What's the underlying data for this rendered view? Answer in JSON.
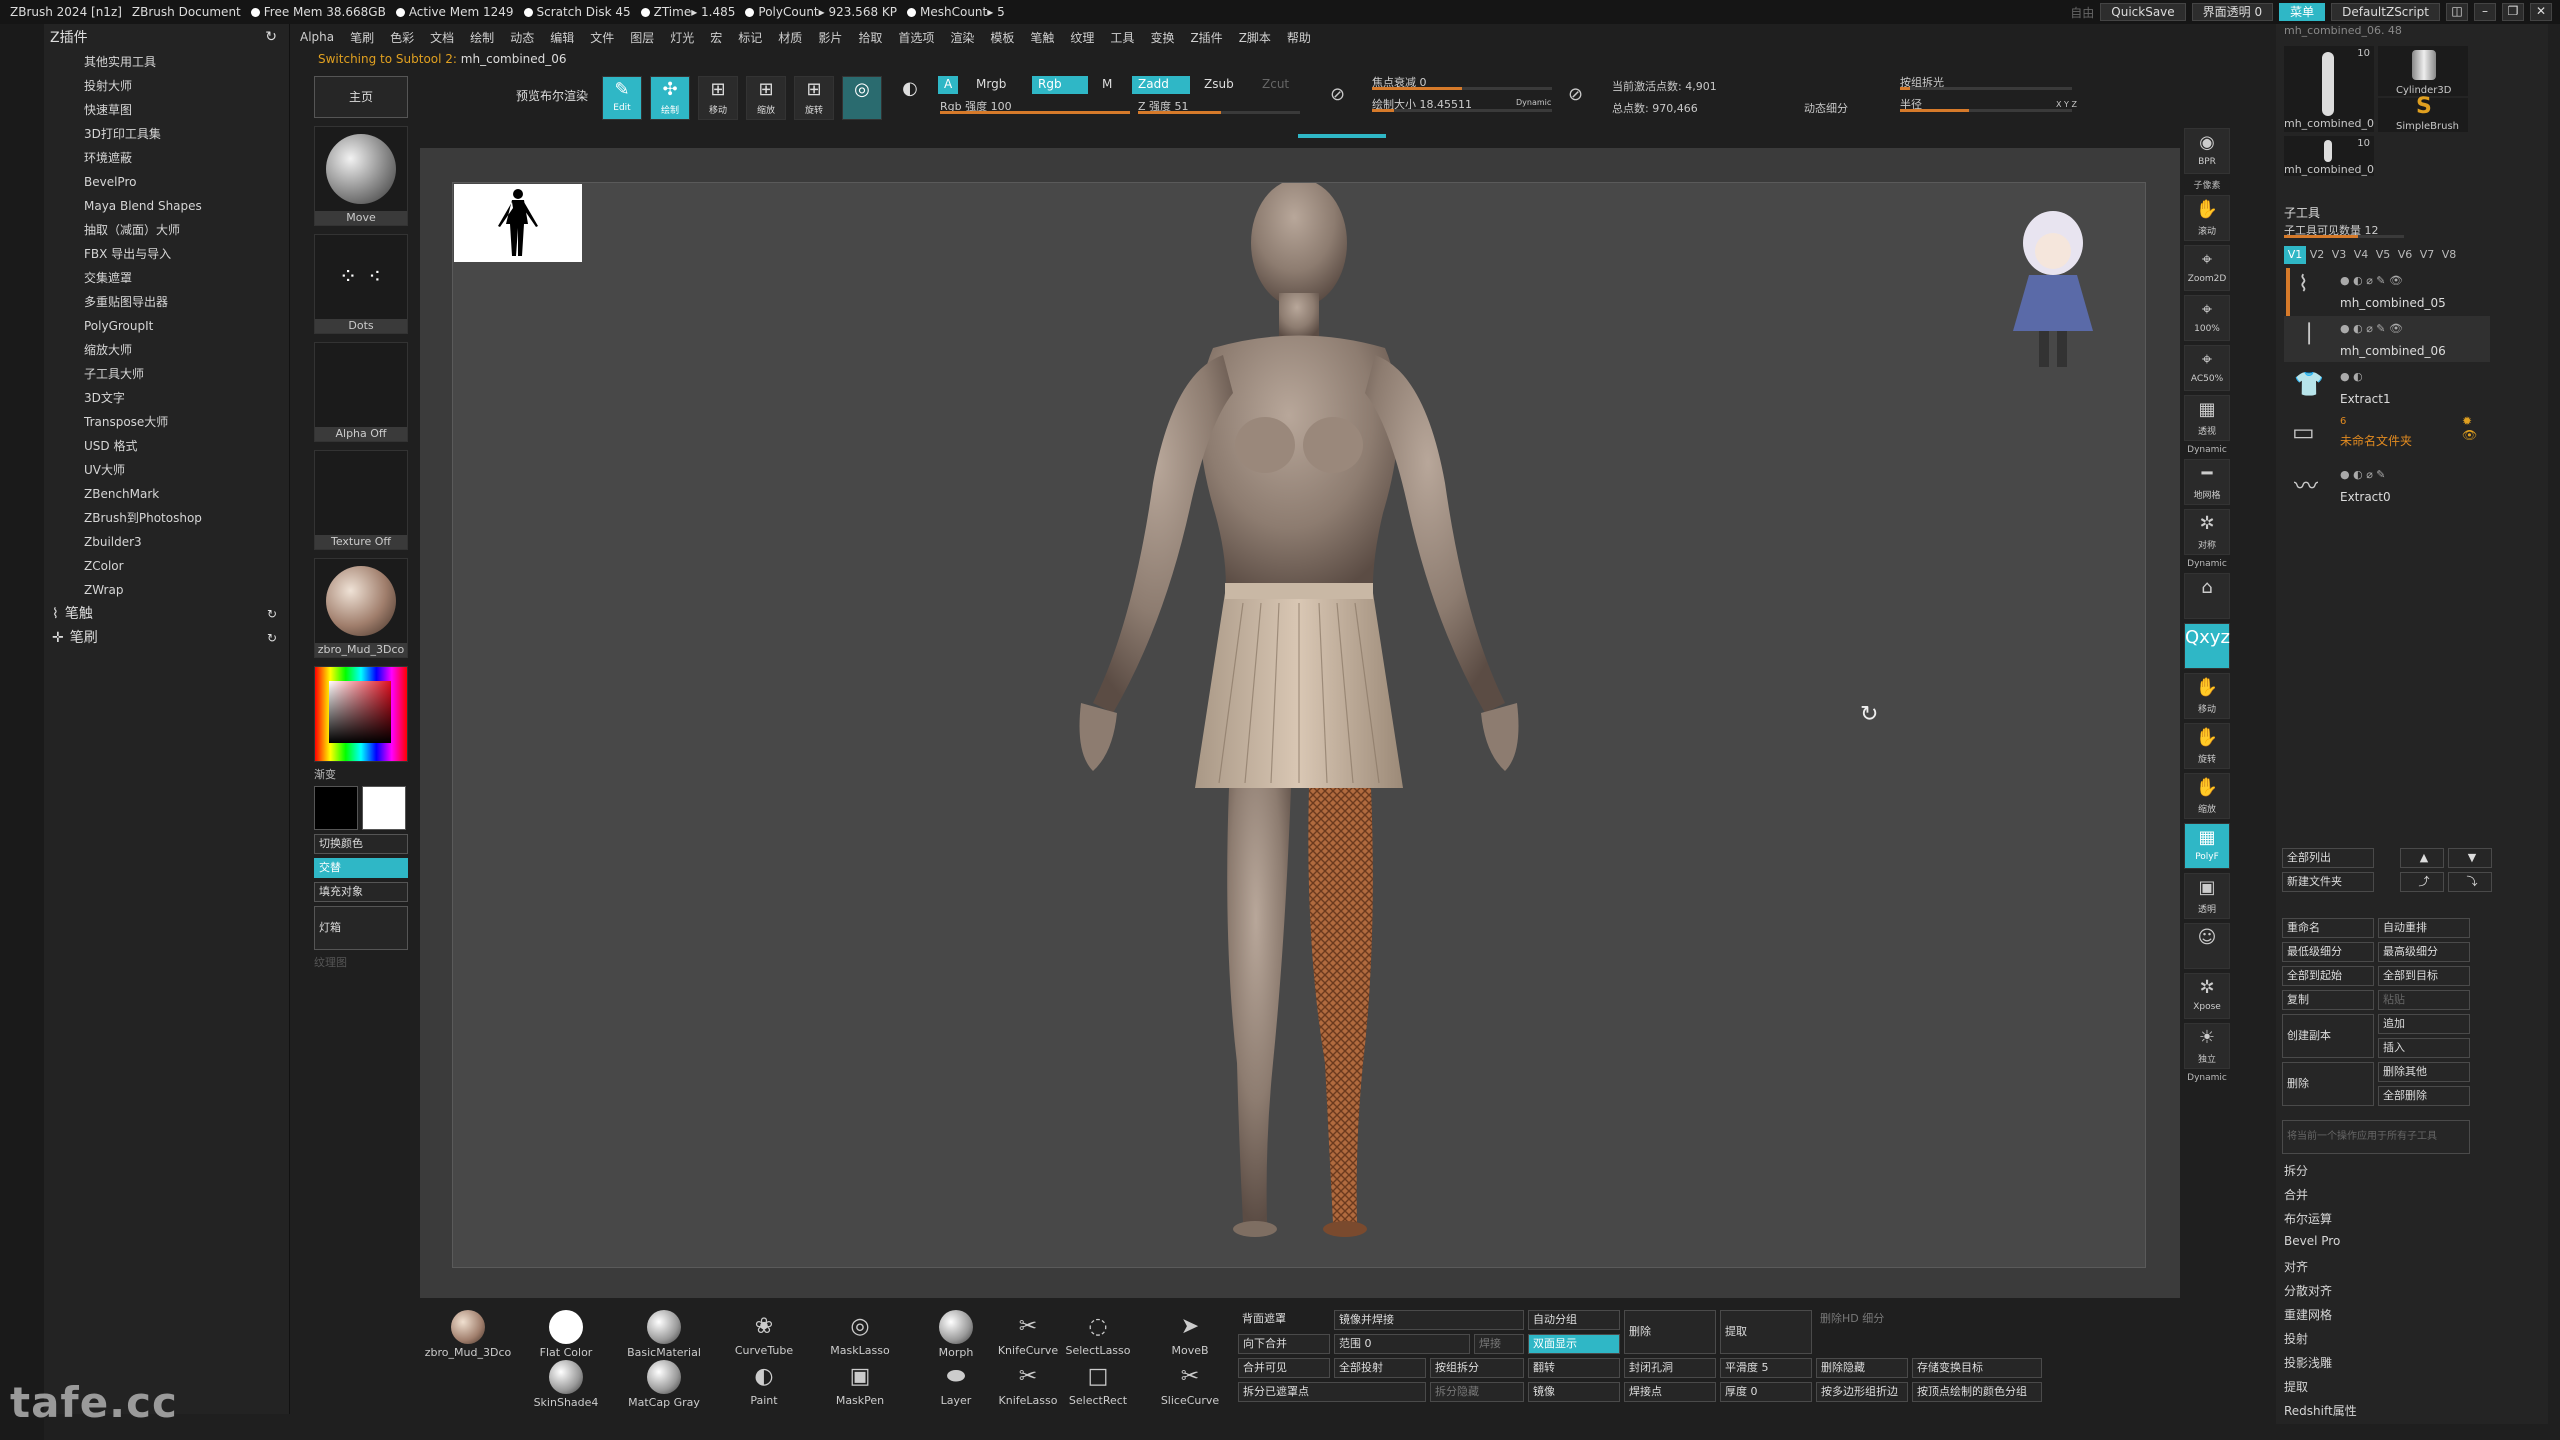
{
  "titlebar": {
    "app": "ZBrush 2024 [n1z]",
    "doc": "ZBrush Document",
    "stats": [
      "Free Mem 38.668GB",
      "Active Mem 1249",
      "Scratch Disk 45",
      "ZTime▸ 1.485",
      "PolyCount▸ 923.568 KP",
      "MeshCount▸ 5"
    ],
    "auto_label": "自由",
    "quicksave": "QuickSave",
    "transparency": "界面透明 0",
    "menu": "菜单",
    "script": "DefaultZScript"
  },
  "menubar": [
    "Alpha",
    "笔刷",
    "色彩",
    "文档",
    "绘制",
    "动态",
    "编辑",
    "文件",
    "图层",
    "灯光",
    "宏",
    "标记",
    "材质",
    "影片",
    "拾取",
    "首选项",
    "渲染",
    "模板",
    "笔触",
    "纹理",
    "工具",
    "变换",
    "Z插件",
    "Z脚本",
    "帮助"
  ],
  "leftpanel": {
    "title": "Z插件",
    "items": [
      "其他实用工具",
      "投射大师",
      "快速草图",
      "3D打印工具集",
      "环境遮蔽",
      "BevelPro",
      "Maya Blend Shapes",
      "抽取（减面）大师",
      "FBX 导出与导入",
      "交集遮罩",
      "多重贴图导出器",
      "PolyGroupIt",
      "缩放大师",
      "子工具大师",
      "3D文字",
      "Transpose大师",
      "USD 格式",
      "UV大师",
      "ZBenchMark",
      "ZBrush到Photoshop",
      "Zbuilder3",
      "ZColor",
      "ZWrap"
    ],
    "groups": [
      "笔触",
      "笔刷"
    ]
  },
  "infobar": {
    "message": "Switching to Subtool 2:",
    "subtool": "mh_combined_06"
  },
  "brushcol": {
    "home": "主页",
    "move": "Move",
    "dots": "Dots",
    "alpha": "Alpha Off",
    "texture": "Texture Off",
    "material": "zbro_Mud_3Dco",
    "gradient_label": "渐变",
    "switch_color": "切换颜色",
    "alternate": "交替",
    "fill": "填充对象",
    "light": "灯箱",
    "texture_map": "纹理图"
  },
  "toolbar": {
    "preview_render": "预览布尔渲染",
    "edit": "Edit",
    "draw": "绘制",
    "move": "移动",
    "scale": "缩放",
    "rotate": "旋转",
    "a_btn": "A",
    "mrgb": "Mrgb",
    "rgb": "Rgb",
    "m": "M",
    "rgb_intensity": "Rgb 强度 100",
    "zadd": "Zadd",
    "zsub": "Zsub",
    "zcut": "Zcut",
    "z_intensity": "Z 强度 51",
    "focal": "焦点衰减 0",
    "draw_size": "绘制大小 18.45511",
    "dynamic": "Dynamic",
    "active_points": "当前激活点数: 4,901",
    "total_points": "总点数: 970,466",
    "dynamic_subdiv": "动态细分",
    "group_split": "按组拆光",
    "radius": "半径",
    "xyz_small": "X Y Z"
  },
  "rightshelf": [
    {
      "icon": "bpr-icon",
      "glyph": "◉",
      "label": "BPR",
      "sub": "子像素"
    },
    {
      "icon": "scroll-icon",
      "glyph": "✋",
      "label": "滚动"
    },
    {
      "icon": "zoom2d-icon",
      "glyph": "⌖",
      "label": "Zoom2D"
    },
    {
      "icon": "zoom100-icon",
      "glyph": "⌖",
      "label": "100%"
    },
    {
      "icon": "zoom50-icon",
      "glyph": "⌖",
      "label": "AC50%"
    },
    {
      "icon": "perspective-icon",
      "glyph": "▦",
      "label": "透视",
      "sub": "Dynamic"
    },
    {
      "icon": "floor-icon",
      "glyph": "━",
      "label": "地网格"
    },
    {
      "icon": "solo-icon",
      "glyph": "✲",
      "label": "对称",
      "sub": "Dynamic"
    },
    {
      "icon": "lock-icon",
      "glyph": "⌂",
      "label": ""
    },
    {
      "icon": "xyz-icon",
      "glyph": "Qxyz",
      "label": "",
      "accent": true
    },
    {
      "icon": "frame-icon",
      "glyph": "✋",
      "label": "移动"
    },
    {
      "icon": "rotate-icon",
      "glyph": "✋",
      "label": "旋转"
    },
    {
      "icon": "scale-icon",
      "glyph": "✋",
      "label": "缩放"
    },
    {
      "icon": "polyf-icon",
      "glyph": "▦",
      "label": "PolyF",
      "accent": true
    },
    {
      "icon": "transp-icon",
      "glyph": "▣",
      "label": "透明"
    },
    {
      "icon": "ghost-icon",
      "glyph": "☺",
      "label": ""
    },
    {
      "icon": "xpose-icon",
      "glyph": "✲",
      "label": "Xpose"
    },
    {
      "icon": "solo2-icon",
      "glyph": "☀",
      "label": "独立",
      "sub": "Dynamic"
    }
  ],
  "rightpanel": {
    "tool_name": "mh_combined_06. 48",
    "thumbs": [
      {
        "name": "mh_combined_0",
        "count": "10"
      },
      {
        "name": "Cylinder3D",
        "count": ""
      },
      {
        "name": "SimpleBrush",
        "count": ""
      },
      {
        "name": "mh_combined_0",
        "count": "10"
      }
    ],
    "subtool_title": "子工具",
    "visible_count": "子工具可见数量 12",
    "vtabs": [
      "V1",
      "V2",
      "V3",
      "V4",
      "V5",
      "V6",
      "V7",
      "V8"
    ],
    "subtools": [
      "mh_combined_05",
      "mh_combined_06",
      "Extract1",
      "未命名文件夹",
      "Extract0"
    ],
    "folder_count": "6",
    "list_all": "全部列出",
    "new_folder": "新建文件夹",
    "buttons": [
      [
        "重命名",
        "自动重排"
      ],
      [
        "最低级细分",
        "最高级细分"
      ],
      [
        "全部到起始",
        "全部到目标"
      ],
      [
        "复制",
        "粘贴"
      ]
    ],
    "create_copy": "创建副本",
    "append": "追加",
    "insert": "插入",
    "delete": "删除",
    "delete_other": "删除其他",
    "delete_all": "全部删除",
    "hint": "将当前一个操作应用于所有子工具",
    "links": [
      "拆分",
      "合并",
      "布尔运算",
      "Bevel Pro",
      "对齐",
      "分散对齐",
      "重建网格",
      "投射",
      "投影浅雕",
      "提取",
      "Redshift属性"
    ]
  },
  "bottomshelf": {
    "brushes": [
      {
        "name": "zbro_Mud_3Dco",
        "kind": "mud"
      },
      {
        "name": "Flat Color",
        "kind": "flat"
      },
      {
        "name": "BasicMaterial",
        "kind": "ball"
      },
      {
        "name": "CurveTube",
        "kind": "icon",
        "glyph": "❀"
      },
      {
        "name": "MaskLasso",
        "kind": "icon",
        "glyph": "◎"
      },
      {
        "name": "Morph",
        "kind": "ball"
      },
      {
        "name": "KnifeCurve",
        "kind": "icon",
        "glyph": "✂"
      },
      {
        "name": "SelectLasso",
        "kind": "icon",
        "glyph": "◌"
      },
      {
        "name": "MoveB",
        "kind": "icon",
        "glyph": "➤"
      },
      {
        "name": "SkinShade4",
        "kind": "ball"
      },
      {
        "name": "MatCap Gray",
        "kind": "ball"
      },
      {
        "name": "Paint",
        "kind": "icon",
        "glyph": "◐"
      },
      {
        "name": "MaskPen",
        "kind": "icon",
        "glyph": "▣"
      },
      {
        "name": "Layer",
        "kind": "icon",
        "glyph": "⬬"
      },
      {
        "name": "KnifeLasso",
        "kind": "icon",
        "glyph": "✂"
      },
      {
        "name": "SelectRect",
        "kind": "icon",
        "glyph": "□"
      },
      {
        "name": "SliceCurve",
        "kind": "icon",
        "glyph": "✂"
      }
    ],
    "cells": {
      "back_mask": "背面遮罩",
      "mirror_weld": "镜像并焊接",
      "auto_group": "自动分组",
      "delete": "删除",
      "extract": "提取",
      "del_hd": "删除HD 细分",
      "merge_down": "向下合并",
      "range": "范围 0",
      "weld": "焊接",
      "double_side": "双面显示",
      "merge_visible": "合并可见",
      "project_all": "全部投射",
      "group_split": "按组拆分",
      "flip": "翻转",
      "close_holes": "封闭孔洞",
      "smooth": "平滑度 5",
      "del_hidden": "删除隐藏",
      "store_morph": "存储变换目标",
      "split_masked": "拆分已遮罩点",
      "split_hidden": "拆分隐藏",
      "mirror": "镜像",
      "weld_points": "焊接点",
      "thickness": "厚度 0",
      "poly_edge": "按多边形组折边",
      "polypaint_group": "按顶点绘制的颜色分组"
    }
  },
  "watermark": "tafe.cc",
  "colors": {
    "accent": "#2fb7c6",
    "warning": "#e0a020",
    "slider_fill": "#d67a2a",
    "canvas": "#484848"
  }
}
